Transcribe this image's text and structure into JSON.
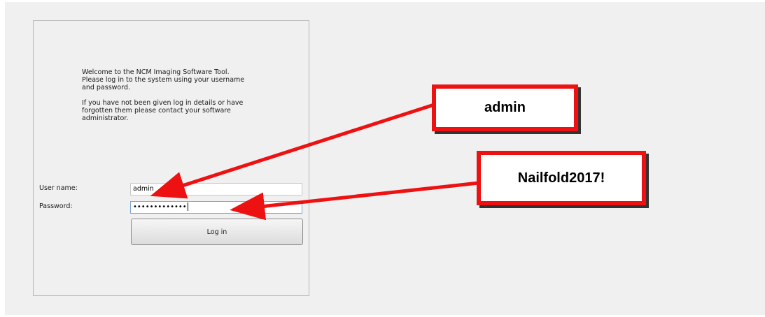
{
  "login": {
    "welcome_line1": "Welcome to the NCM Imaging Software Tool.",
    "welcome_line2": "Please log in to the system using your username",
    "welcome_line3": "and password.",
    "help_line1": "If you have not been given log in details or have",
    "help_line2": "forgotten them please contact your software",
    "help_line3": "administrator.",
    "username_label": "User name:",
    "username_value": "admin",
    "password_label": "Password:",
    "password_masked": "•••••••••••••",
    "login_button": "Log in"
  },
  "annotations": {
    "username_callout": "admin",
    "password_callout": "Nailfold2017!",
    "callout_border_color": "#ee1111",
    "arrow_color": "#ee1111"
  }
}
